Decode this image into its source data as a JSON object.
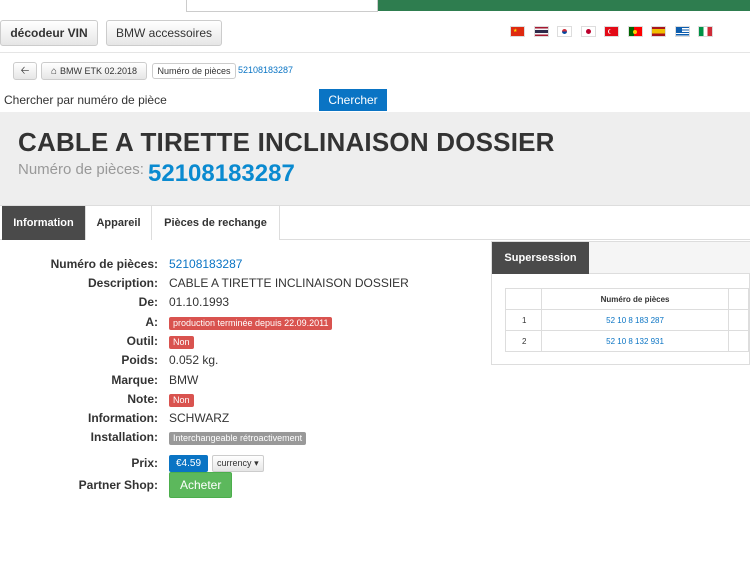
{
  "topbar": {
    "vin_button": "décodeur VIN",
    "accessories_button": "BMW accessoires",
    "flags": [
      "china-flag-icon",
      "thailand-flag-icon",
      "korea-flag-icon",
      "japan-flag-icon",
      "turkey-flag-icon",
      "portugal-flag-icon",
      "spain-flag-icon",
      "greece-flag-icon",
      "italy-flag-icon"
    ]
  },
  "breadcrumb": {
    "catalog": "BMW ETK 02.2018",
    "parts_label": "Numéro de pièces",
    "part_link": "52108183287"
  },
  "search": {
    "label": "Chercher par numéro de pièce",
    "button": "Chercher"
  },
  "part": {
    "title": "CABLE A TIRETTE INCLINAISON DOSSIER",
    "number_label": "Numéro de pièces:",
    "number": "52108183287"
  },
  "tabs": [
    {
      "label": "Information"
    },
    {
      "label": "Appareil"
    },
    {
      "label": "Pièces de rechange"
    }
  ],
  "details": {
    "number_label": "Numéro de pièces:",
    "number_value": "52108183287",
    "description_label": "Description:",
    "description_value": "CABLE A TIRETTE INCLINAISON DOSSIER",
    "from_label": "De:",
    "from_value": "01.10.1993",
    "to_label": "A:",
    "to_value": "production terminée depuis 22.09.2011",
    "tool_label": "Outil:",
    "tool_value": "Non",
    "weight_label": "Poids:",
    "weight_value": "0.052 kg.",
    "brand_label": "Marque:",
    "brand_value": "BMW",
    "note_label": "Note:",
    "note_value": "Non",
    "info_label": "Information:",
    "info_value": "SCHWARZ",
    "install_label": "Installation:",
    "install_value": "Interchangeable rétroactivement",
    "price_label": "Prix:",
    "price_value": "€4.59",
    "currency_button": "currency",
    "shop_label": "Partner Shop:",
    "buy_button": "Acheter"
  },
  "supersession": {
    "tab": "Supersession",
    "column": "Numéro de pièces",
    "rows": [
      {
        "index": "1",
        "number": "52 10 8 183 287"
      },
      {
        "index": "2",
        "number": "52 10 8 132 931"
      }
    ]
  },
  "colors": {
    "accent_blue": "#0a74c4",
    "danger_red": "#d9534f",
    "success_green": "#5cb85c",
    "tab_dark": "#4a4a4a"
  }
}
